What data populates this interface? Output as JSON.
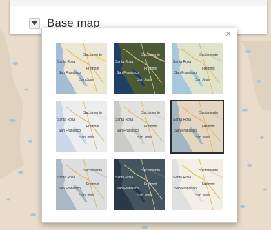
{
  "header": {
    "title": "Base map",
    "toggle_icon": "chevron-down-icon"
  },
  "popup": {
    "close_icon": "close-icon",
    "close_symbol": "×",
    "tiles": [
      {
        "style": "streets",
        "labels": [
          "Sacramento",
          "Santa Rosa",
          "San Francisco",
          "Fremont",
          "San Jose"
        ],
        "land": "#ece6d4",
        "water": "#a4bcd6",
        "accent": "#f6d36b"
      },
      {
        "style": "imagery",
        "labels": [
          "Sacramento",
          "Santa Rosa",
          "San Francisco",
          "Fremont",
          "San Jose"
        ],
        "land": "#4b5a35",
        "water": "#1f3f67",
        "accent": "#c9b27a"
      },
      {
        "style": "topographic",
        "labels": [
          "Sacramento",
          "Santa Rosa",
          "San Francisco",
          "Fremont",
          "San Jose"
        ],
        "land": "#dfe3cc",
        "water": "#a7c7da",
        "accent": "#d8d1b3"
      },
      {
        "style": "light-gray",
        "labels": [
          "Sacramento",
          "Santa Rosa",
          "San Francisco",
          "Fremont",
          "San Jose"
        ],
        "land": "#ecedef",
        "water": "#cdd7ea",
        "accent": "#dde0e5"
      },
      {
        "style": "gray",
        "labels": [
          "Sacramento",
          "Santa Rosa",
          "San Francisco",
          "Fremont",
          "San Jose"
        ],
        "land": "#e1e1de",
        "water": "#cacac8",
        "accent": "#d5d5d1"
      },
      {
        "style": "oceans",
        "labels": [
          "Sacramento",
          "Santa Rosa",
          "San Francisco",
          "Fremont",
          "San Jose"
        ],
        "land": "#e3d6c2",
        "water": "#a3b6c2",
        "accent": "#d9cbb4"
      },
      {
        "style": "terrain",
        "labels": [
          "Sacramento",
          "Santa Rosa",
          "San Francisco",
          "Fremont",
          "San Jose"
        ],
        "land": "#dcdedf",
        "water": "#a8b8c4",
        "accent": "#c9cccd"
      },
      {
        "style": "dark-gray",
        "labels": [
          "Sacramento",
          "Santa Rosa",
          "San Francisco",
          "Fremont",
          "San Jose"
        ],
        "land": "#445560",
        "water": "#2a3945",
        "accent": "#566672"
      },
      {
        "style": "national-geographic",
        "labels": [
          "Sacramento",
          "Santa Rosa",
          "San Francisco",
          "Fremont",
          "San Jose"
        ],
        "land": "#f4efe6",
        "water": "#dfe0e0",
        "accent": "#ecd9c4"
      }
    ],
    "selected_index": 5
  },
  "colors": {
    "map_land": "#e9dccb",
    "map_water": "#a7c4d9",
    "panel": "#ffffff"
  }
}
